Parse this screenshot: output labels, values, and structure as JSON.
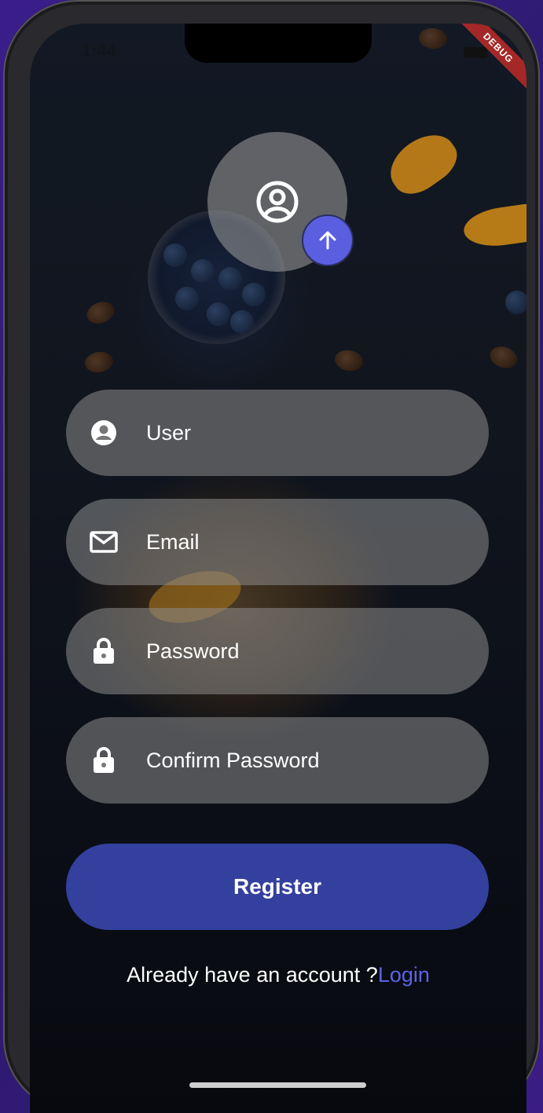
{
  "status_bar": {
    "time": "1:44",
    "debug_banner": "DEBUG"
  },
  "avatar": {
    "icon": "account-circle-icon",
    "upload_icon": "arrow-up-icon"
  },
  "form": {
    "user": {
      "icon": "person-icon",
      "placeholder": "User",
      "value": ""
    },
    "email": {
      "icon": "mail-icon",
      "placeholder": "Email",
      "value": ""
    },
    "password": {
      "icon": "lock-icon",
      "placeholder": "Password",
      "value": ""
    },
    "confirm_password": {
      "icon": "lock-icon",
      "placeholder": "Confirm Password",
      "value": ""
    }
  },
  "register_button": {
    "label": "Register"
  },
  "footer": {
    "text": "Already have an account ?",
    "link": "Login"
  },
  "colors": {
    "accent": "#5a5fe0",
    "button": "#34409e",
    "link": "#5b63e6"
  }
}
